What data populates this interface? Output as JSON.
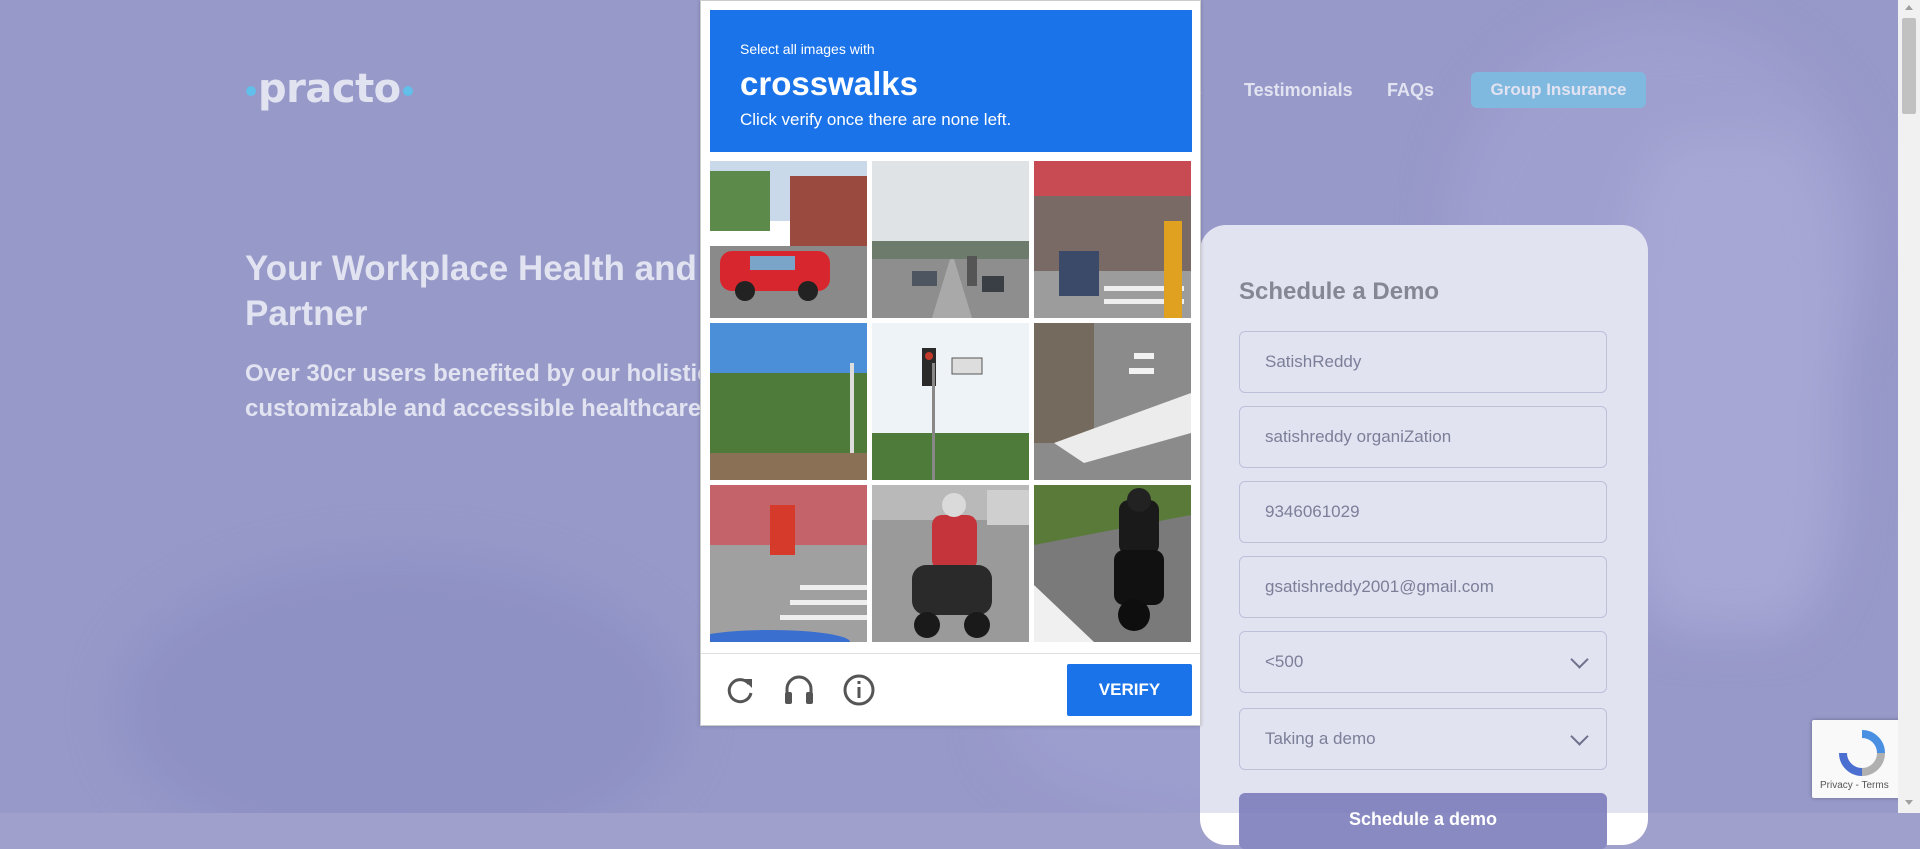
{
  "header": {
    "logo": "practo",
    "nav_partial": "s",
    "nav_testimonials": "Testimonials",
    "nav_faqs": "FAQs",
    "group_insurance": "Group Insurance"
  },
  "hero": {
    "title": "Your Workplace Health and W Partner",
    "title_line1": "Your Workplace Health and W",
    "title_line2": "Partner",
    "subtitle_line1": "Over 30cr users benefited by our holistic,",
    "subtitle_line2": "customizable and accessible healthcare s"
  },
  "form": {
    "title": "Schedule a Demo",
    "name_value": "SatishReddy",
    "org_value": " satishreddy organiZation",
    "phone_value": "9346061029",
    "email_value": "gsatishreddy2001@gmail.com",
    "size_value": "<500",
    "reason_value": "Taking a demo",
    "submit_label": "Schedule a demo"
  },
  "captcha": {
    "instruction_small": "Select all images with",
    "instruction_target": "crosswalks",
    "instruction_note": "Click verify once there are none left.",
    "verify_label": "VERIFY",
    "icons": [
      "reload-icon",
      "audio-headphones-icon",
      "info-icon"
    ]
  },
  "recaptcha_badge": {
    "text": "Privacy - Terms"
  },
  "colors": {
    "captcha_blue": "#1a73e8",
    "insurance_button": "#82c9ea",
    "background": "#9fa0cc"
  }
}
